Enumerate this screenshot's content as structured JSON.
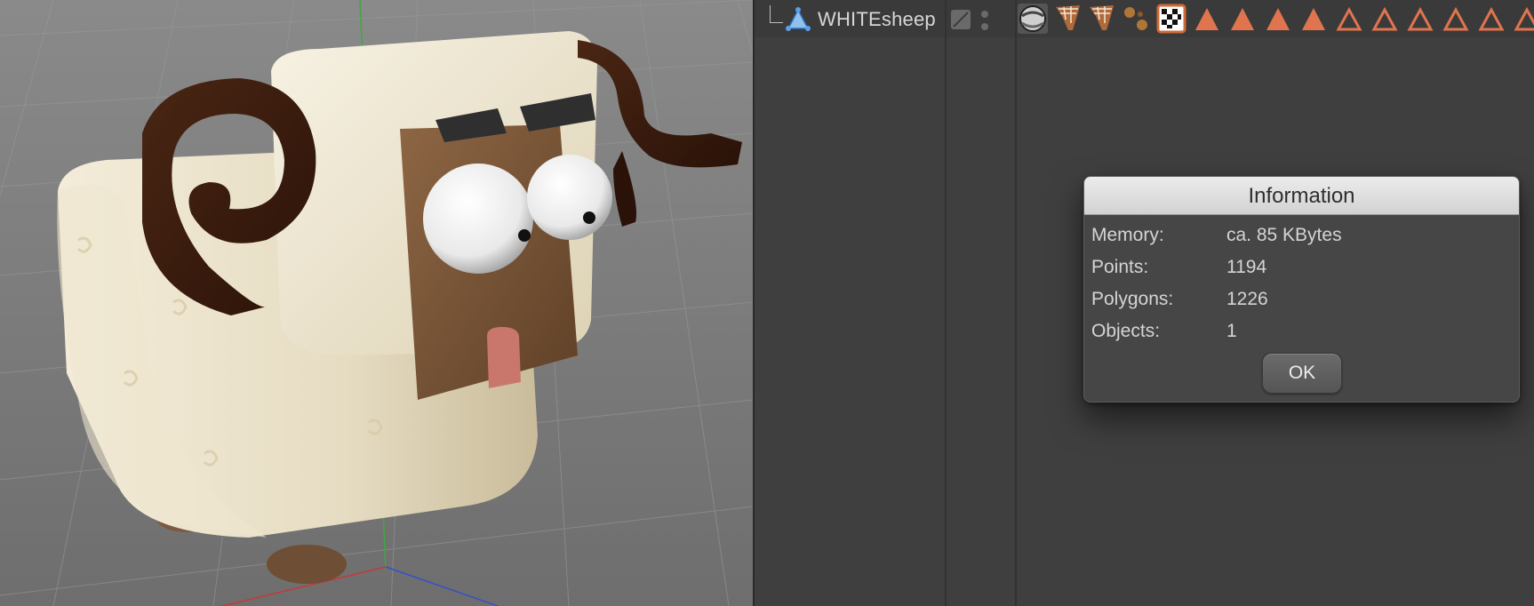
{
  "viewport": {
    "scene_label": "3D viewport with sheep character model"
  },
  "object_manager": {
    "object_name": "WHITEsheep",
    "object_icon": "polygon-object-icon",
    "tags": [
      "material-sphere-tag-icon",
      "uvw-map-tag-icon",
      "uvw-map-tag-icon",
      "bones-tag-icon",
      "checker-texture-tag-icon",
      "polygon-selection-tag-icon",
      "polygon-selection-tag-icon",
      "polygon-selection-tag-icon",
      "polygon-selection-tag-icon",
      "point-selection-tag-icon",
      "point-selection-tag-icon",
      "point-selection-tag-icon",
      "point-selection-tag-icon",
      "point-selection-tag-icon"
    ],
    "tag_color": "#e0744e"
  },
  "dialog": {
    "title": "Information",
    "rows": [
      {
        "label": "Memory:",
        "value": "ca. 85 KBytes"
      },
      {
        "label": "Points:",
        "value": "1194"
      },
      {
        "label": "Polygons:",
        "value": "1226"
      },
      {
        "label": "Objects:",
        "value": "1"
      }
    ],
    "ok_label": "OK"
  }
}
